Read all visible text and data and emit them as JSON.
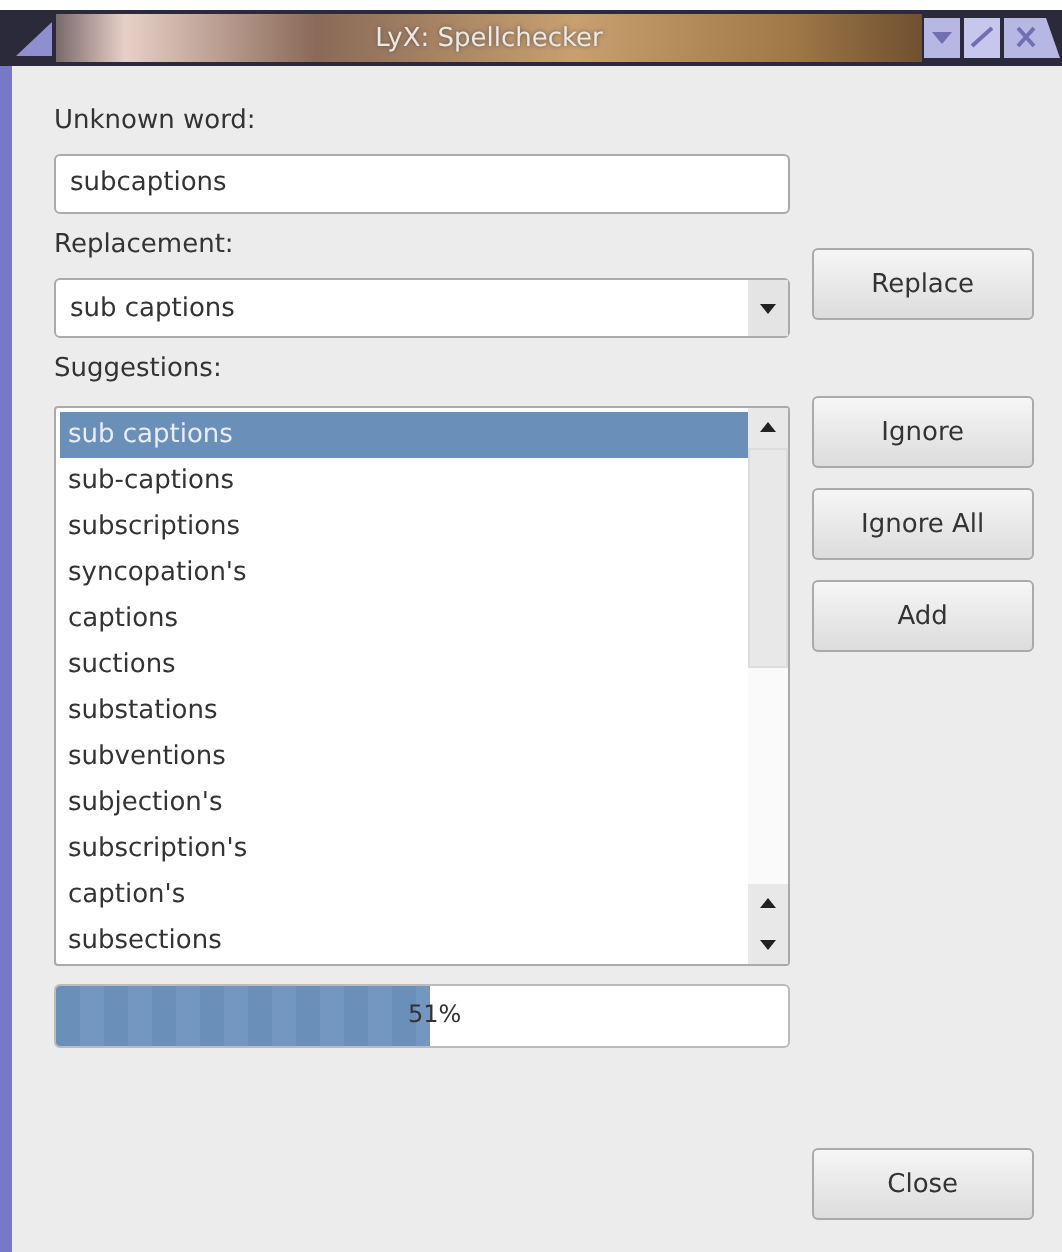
{
  "window": {
    "title": "LyX: Spellchecker"
  },
  "unknown_word": {
    "label": "Unknown word:",
    "value": "subcaptions"
  },
  "replacement": {
    "label": "Replacement:",
    "value": "sub captions"
  },
  "suggestions": {
    "label": "Suggestions:",
    "items": [
      {
        "text": "sub captions",
        "selected": true
      },
      {
        "text": "sub-captions",
        "selected": false
      },
      {
        "text": "subscriptions",
        "selected": false
      },
      {
        "text": "syncopation's",
        "selected": false
      },
      {
        "text": "captions",
        "selected": false
      },
      {
        "text": "suctions",
        "selected": false
      },
      {
        "text": "substations",
        "selected": false
      },
      {
        "text": "subventions",
        "selected": false
      },
      {
        "text": "subjection's",
        "selected": false
      },
      {
        "text": "subscription's",
        "selected": false
      },
      {
        "text": "caption's",
        "selected": false
      },
      {
        "text": "subsections",
        "selected": false
      }
    ]
  },
  "progress": {
    "level": 0.51,
    "reading": "51%"
  },
  "buttons": {
    "replace": "Replace",
    "ignore": "Ignore",
    "ignore_all": "Ignore All",
    "add": "Add",
    "close": "Close"
  }
}
